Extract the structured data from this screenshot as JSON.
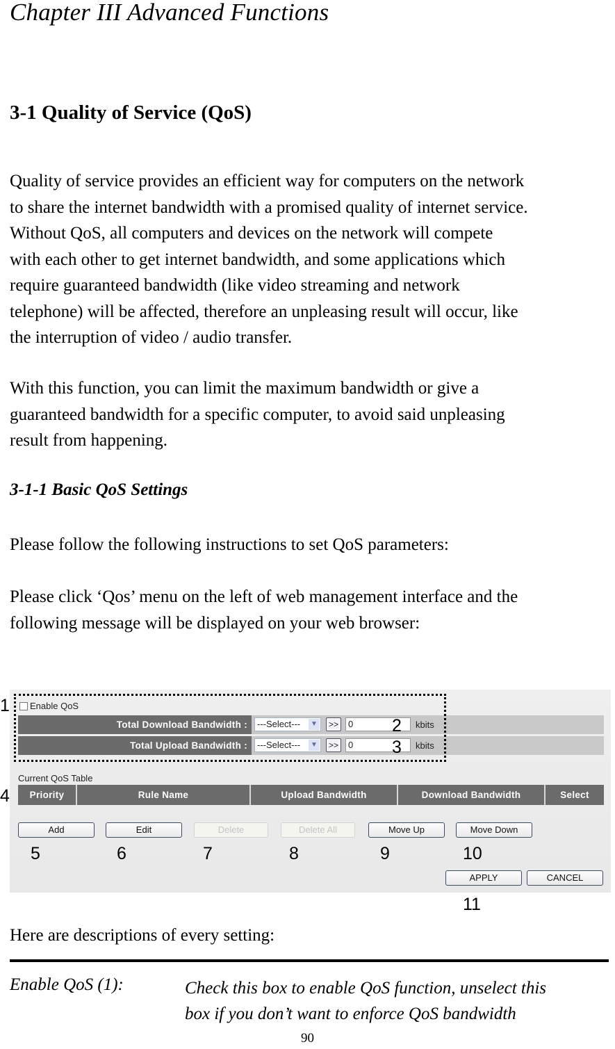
{
  "chapter_title": "Chapter III Advanced Functions",
  "section_title": "3-1 Quality of Service (QoS)",
  "intro_paragraph": [
    "Quality of service provides an efficient way for computers on the network",
    "to share the internet bandwidth with a promised quality of internet service.",
    "Without QoS, all computers and devices on the network will compete",
    "with each other to get internet bandwidth, and some applications which",
    "require guaranteed bandwidth (like video streaming and network",
    "telephone) will be affected, therefore an unpleasing result will occur, like",
    "the interruption of video / audio transfer."
  ],
  "function_paragraph": [
    "With this function, you can limit the maximum bandwidth or give a",
    "guaranteed bandwidth for a specific computer, to avoid said unpleasing",
    "result from happening."
  ],
  "subsection_title": "3-1-1 Basic QoS Settings",
  "instructions_paragraph": "Please follow the following instructions to set QoS parameters:",
  "click_paragraph": [
    "Please click ‘Qos’ menu on the left of web management interface and the",
    "following message will be displayed on your web browser:"
  ],
  "screenshot": {
    "enable_qos": {
      "label": "Enable QoS",
      "checked": false
    },
    "download": {
      "label": "Total Download Bandwidth :",
      "select": "---Select---",
      "go": ">>",
      "value": "0",
      "unit": "kbits"
    },
    "upload": {
      "label": "Total Upload Bandwidth :",
      "select": "---Select---",
      "go": ">>",
      "value": "0",
      "unit": "kbits"
    },
    "table_title": "Current QoS Table",
    "table_columns": [
      "Priority",
      "Rule Name",
      "Upload Bandwidth",
      "Download Bandwidth",
      "Select"
    ],
    "buttons": {
      "add": "Add",
      "edit": "Edit",
      "delete": "Delete",
      "delete_all": "Delete All",
      "move_up": "Move Up",
      "move_down": "Move Down",
      "apply": "APPLY",
      "cancel": "CANCEL"
    }
  },
  "callouts": [
    "1",
    "2",
    "3",
    "4",
    "5",
    "6",
    "7",
    "8",
    "9",
    "10",
    "11"
  ],
  "descriptions_intro": "Here are descriptions of every setting:",
  "definitions": [
    {
      "term": "Enable QoS (1):",
      "description": [
        "Check this box to enable QoS function, unselect this",
        "box if you don’t want to enforce QoS bandwidth"
      ]
    }
  ],
  "page_number": "90"
}
